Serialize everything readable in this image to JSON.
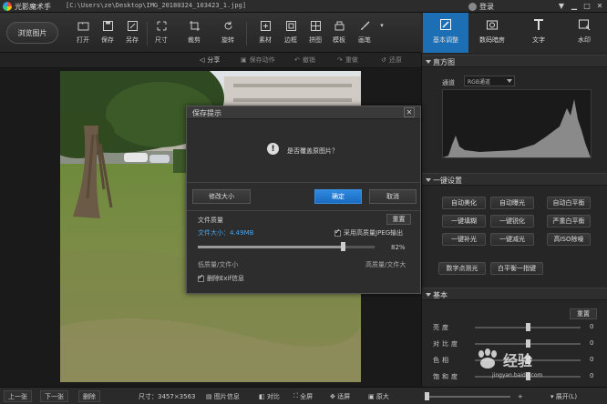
{
  "window": {
    "app_name": "光影魔术手",
    "file_path": "[C:\\Users\\ze\\Desktop\\IMG_20180324_103423_1.jpg]",
    "login_label": "登录"
  },
  "toolbar": {
    "browse_label": "浏览图片",
    "tools": [
      {
        "label": "打开",
        "icon": "open-icon"
      },
      {
        "label": "保存",
        "icon": "save-icon"
      },
      {
        "label": "另存",
        "icon": "save-as-icon"
      },
      {
        "label": "尺寸",
        "icon": "resize-icon"
      },
      {
        "label": "裁剪",
        "icon": "crop-icon"
      },
      {
        "label": "旋转",
        "icon": "rotate-icon"
      },
      {
        "label": "素材",
        "icon": "material-icon"
      },
      {
        "label": "边框",
        "icon": "border-icon"
      },
      {
        "label": "拼图",
        "icon": "collage-icon"
      },
      {
        "label": "模板",
        "icon": "template-icon"
      },
      {
        "label": "画笔",
        "icon": "brush-icon"
      }
    ]
  },
  "tabs": [
    {
      "label": "基本调整",
      "icon": "basic-adjust-icon",
      "active": true
    },
    {
      "label": "数码暗房",
      "icon": "darkroom-icon",
      "active": false
    },
    {
      "label": "文字",
      "icon": "text-icon",
      "active": false
    },
    {
      "label": "水印",
      "icon": "watermark-icon",
      "active": false
    }
  ],
  "subtoolbar": {
    "share": "分享",
    "save_action": "保存动作",
    "undo": "撤销",
    "redo": "重做",
    "restore": "还原"
  },
  "histogram": {
    "title": "直方图",
    "channel_label": "通道",
    "channel_value": "RGB通道"
  },
  "quick_settings": {
    "title": "一键设置",
    "buttons": [
      "自动美化",
      "自动曝光",
      "自动白平衡",
      "一键填糊",
      "一键锐化",
      "严重白平衡",
      "一键补光",
      "一键减光",
      "高ISO除噪",
      "数字点测光",
      "白平衡一指键"
    ]
  },
  "basic": {
    "title": "基本",
    "reset_label": "重置",
    "sliders": [
      {
        "label": "亮度",
        "value": "0",
        "level": 0.5
      },
      {
        "label": "对比度",
        "value": "0",
        "level": 0.5
      },
      {
        "label": "色相",
        "value": "0",
        "level": 0.5
      },
      {
        "label": "饱和度",
        "value": "0",
        "level": 0.5
      }
    ]
  },
  "dialog": {
    "title": "保存提示",
    "message": "是否覆盖原图片？",
    "modify_size": "修改大小",
    "ok": "确定",
    "cancel": "取消",
    "quality_title": "文件质量",
    "reset": "重置",
    "file_size": "文件大小：4.49MB",
    "jpeg_option": "采用高质量JPEG输出",
    "quality_value": "82%",
    "quality_level": 0.82,
    "low_label": "低质量/文件小",
    "high_label": "高质量/文件大",
    "exif_option": "删除Exif信息"
  },
  "statusbar": {
    "prev": "上一张",
    "next": "下一张",
    "delete": "删除",
    "size": "尺寸：3457×3563",
    "image_info": "图片信息",
    "compare": "对比",
    "fullscreen": "全屏",
    "fit": "适屏",
    "original": "原大",
    "expand": "展开(L)"
  },
  "watermark": {
    "text": "经验",
    "url": "jingyan.baidu.com"
  }
}
